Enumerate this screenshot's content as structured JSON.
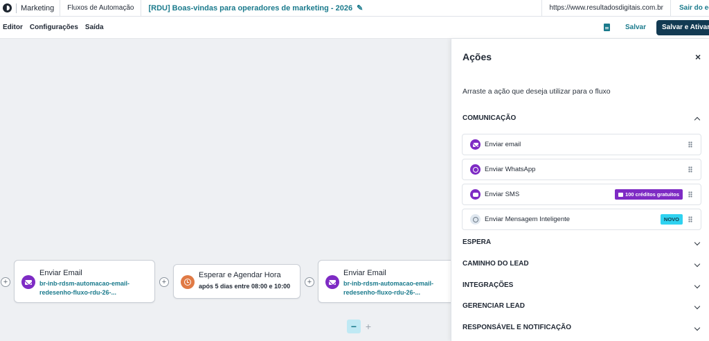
{
  "topbar": {
    "brand": "Marketing",
    "breadcrumb": "Fluxos de Automação",
    "flow_title": "[RDU] Boas-vindas para operadores de marketing - 2026",
    "url": "https://www.resultadosdigitais.com.br",
    "exit_label": "Sair do editor"
  },
  "menu": {
    "items": [
      "Editor",
      "Configurações",
      "Saída"
    ],
    "save_label": "Salvar",
    "save_activate_label": "Salvar e Ativar"
  },
  "canvas": {
    "nodes": [
      {
        "title": "Enviar Email",
        "sub1": "br-inb-rdsm-automacao-email-",
        "sub2": "redesenho-fluxo-rdu-26-..."
      },
      {
        "title": "Esperar e Agendar Hora",
        "sub1": "após 5 dias entre 08:00 e 10:00"
      },
      {
        "title": "Enviar Email",
        "sub1": "br-inb-rdsm-automacao-email-",
        "sub2": "redesenho-fluxo-rdu-26-..."
      }
    ],
    "add_symbol": "+",
    "zoom_out": "−",
    "zoom_in": "+"
  },
  "panel": {
    "title": "Ações",
    "close_symbol": "×",
    "description": "Arraste a ação que deseja utilizar para o fluxo",
    "sections": [
      {
        "label": "COMUNICAÇÃO",
        "expanded": true
      },
      {
        "label": "ESPERA"
      },
      {
        "label": "CAMINHO DO LEAD"
      },
      {
        "label": "INTEGRAÇÕES"
      },
      {
        "label": "GERENCIAR LEAD"
      },
      {
        "label": "RESPONSÁVEL E NOTIFICAÇÃO"
      }
    ],
    "actions": [
      {
        "label": "Enviar email",
        "icon": "email-icon"
      },
      {
        "label": "Enviar WhatsApp",
        "icon": "whatsapp-icon"
      },
      {
        "label": "Enviar SMS",
        "icon": "sms-icon",
        "badge": "100 créditos gratuitos"
      },
      {
        "label": "Enviar Mensagem Inteligente",
        "icon": "smart-message-icon",
        "badge": "NOVO"
      }
    ]
  },
  "colors": {
    "accent": "#1a7a8c",
    "primary_dark": "#123a52",
    "purple": "#7e2bc4",
    "orange": "#e07a45",
    "cyan_badge": "#2fd2f0"
  }
}
